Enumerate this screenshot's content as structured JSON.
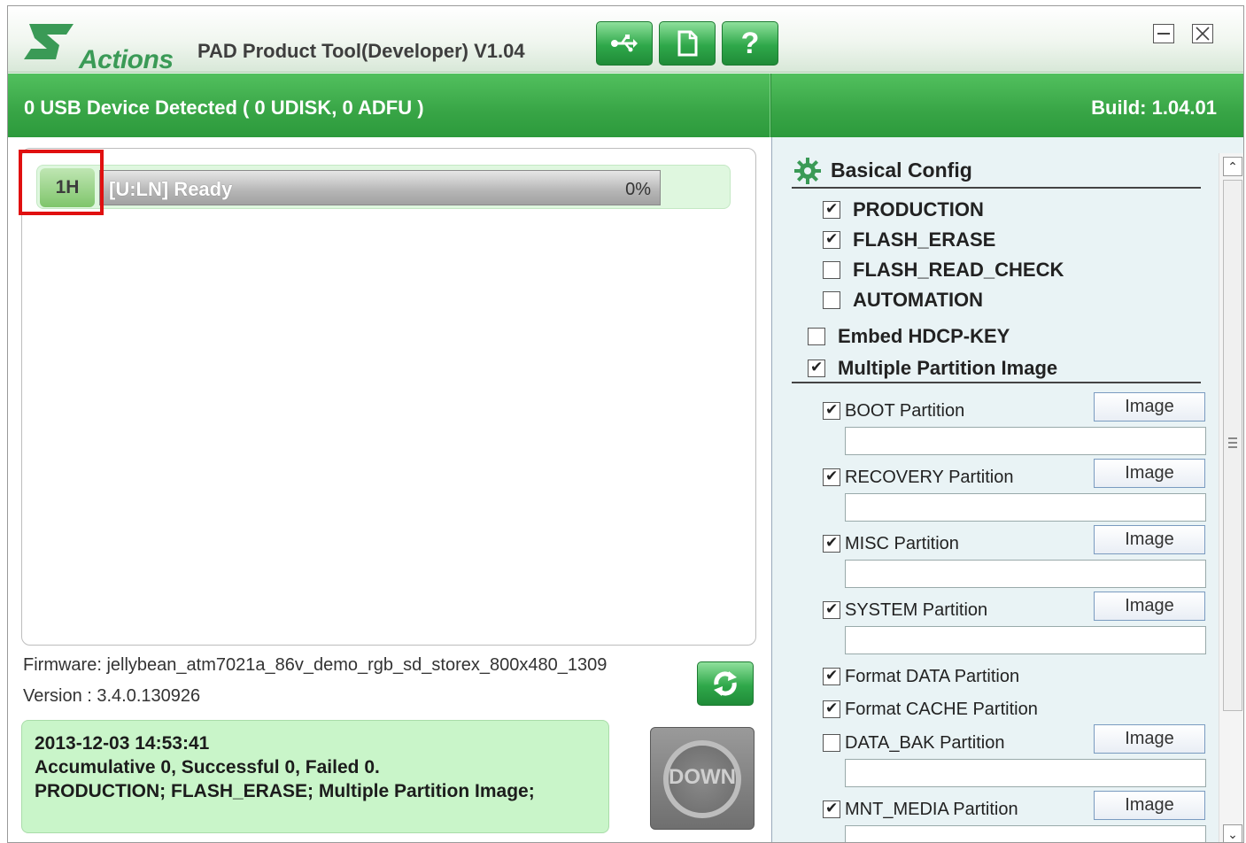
{
  "titlebar": {
    "logo_text": "Actions",
    "title": "PAD Product Tool(Developer) V1.04",
    "help_label": "?"
  },
  "statusbar": {
    "devices_detected": "0 USB Device Detected ( 0 UDISK, 0 ADFU )",
    "build": "Build: 1.04.01"
  },
  "device": {
    "id": "1H",
    "status": "[U:LN] Ready",
    "percent_label": "0%",
    "progress": 0
  },
  "firmware": {
    "firmware_line": "Firmware: jellybean_atm7021a_86v_demo_rgb_sd_storex_800x480_1309",
    "version_line": "Version : 3.4.0.130926"
  },
  "log": {
    "lines": [
      "2013-12-03 14:53:41",
      "Accumulative 0, Successful 0, Failed 0.",
      "PRODUCTION; FLASH_ERASE; Multiple Partition Image;"
    ]
  },
  "down_button": {
    "label": "DOWN"
  },
  "config": {
    "title": "Basical Config",
    "options": [
      {
        "label": "PRODUCTION",
        "checked": true
      },
      {
        "label": "FLASH_ERASE",
        "checked": true
      },
      {
        "label": "FLASH_READ_CHECK",
        "checked": false
      },
      {
        "label": "AUTOMATION",
        "checked": false
      }
    ],
    "embed_hdcp": {
      "label": "Embed HDCP-KEY",
      "checked": false
    },
    "multiple_partition": {
      "label": "Multiple Partition Image",
      "checked": true
    },
    "image_label": "Image",
    "partitions": [
      {
        "label": "BOOT Partition",
        "checked": true
      },
      {
        "label": "RECOVERY Partition",
        "checked": true
      },
      {
        "label": "MISC Partition",
        "checked": true
      },
      {
        "label": "SYSTEM Partition",
        "checked": true
      }
    ],
    "format_data": {
      "label": "Format DATA Partition",
      "checked": true
    },
    "format_cache": {
      "label": "Format CACHE Partition",
      "checked": true
    },
    "data_bak": {
      "label": "DATA_BAK Partition",
      "checked": false
    },
    "mnt_media": {
      "label": "MNT_MEDIA Partition",
      "checked": true
    }
  },
  "colors": {
    "accent_green": "#38a546",
    "log_background": "#c9f5c9",
    "highlight_red": "#e01010"
  }
}
